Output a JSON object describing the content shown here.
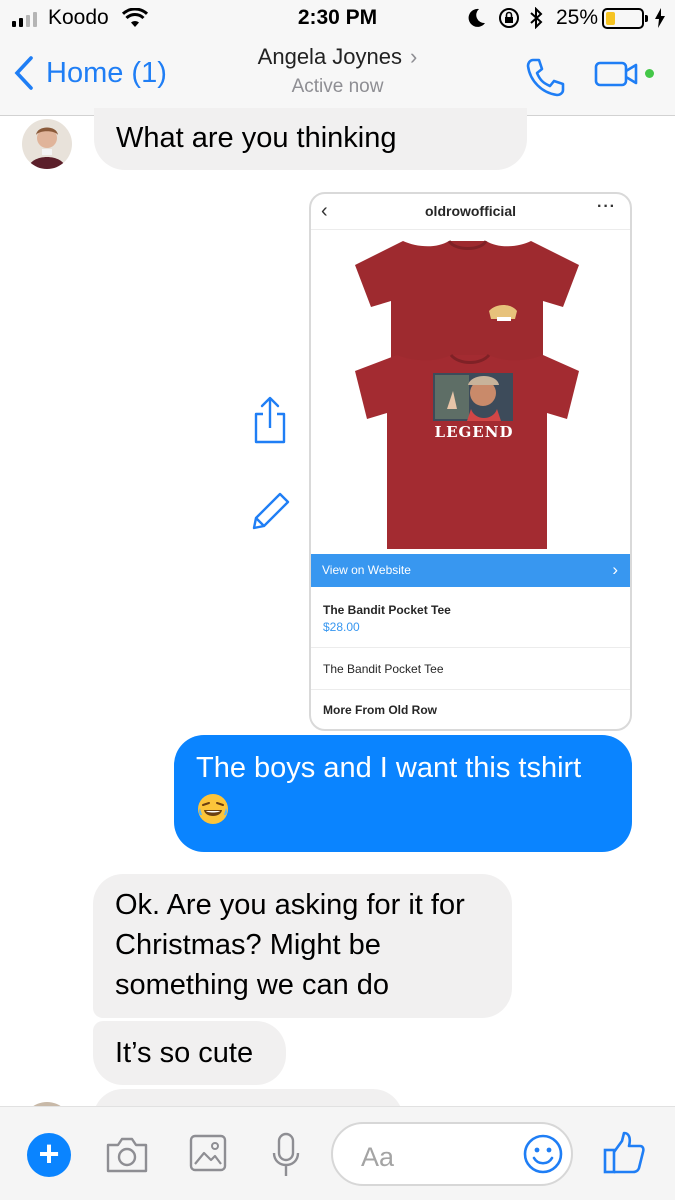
{
  "status_bar": {
    "carrier": "Koodo",
    "time": "2:30 PM",
    "battery_percent": "25%",
    "battery_level": 0.25,
    "signal_bars": 2,
    "icons": [
      "signal-icon",
      "wifi-icon",
      "moon-icon",
      "rotation-lock-icon",
      "bluetooth-icon",
      "battery-icon",
      "charging-icon"
    ]
  },
  "nav": {
    "back_label": "Home (1)",
    "contact_name": "Angela Joynes",
    "presence": "Active now",
    "accent": "#1f7ef5",
    "online_color": "#44c748"
  },
  "messages": [
    {
      "sender": "contact",
      "text": "What are you thinking"
    },
    {
      "sender": "me",
      "text": "The boys and I want this tshirt",
      "emoji": "😂"
    },
    {
      "sender": "contact",
      "text": "Ok. Are you asking for it for Christmas? Might be something we can do"
    },
    {
      "sender": "contact",
      "text": "It’s so cute"
    }
  ],
  "shared_post": {
    "account": "oldrowofficial",
    "shirt_graphic_text": "LEGEND",
    "view_button": "View on Website",
    "product_title": "The Bandit Pocket Tee",
    "product_price": "$28.00",
    "product_name_repeat": "The Bandit Pocket Tee",
    "more_link": "More From Old Row",
    "shirt_color": "#9e2a2f",
    "button_color": "#3897f0"
  },
  "composer": {
    "placeholder": "Aa",
    "bubble_me_color": "#0a84ff",
    "bubble_them_color": "#f1f0f0"
  }
}
